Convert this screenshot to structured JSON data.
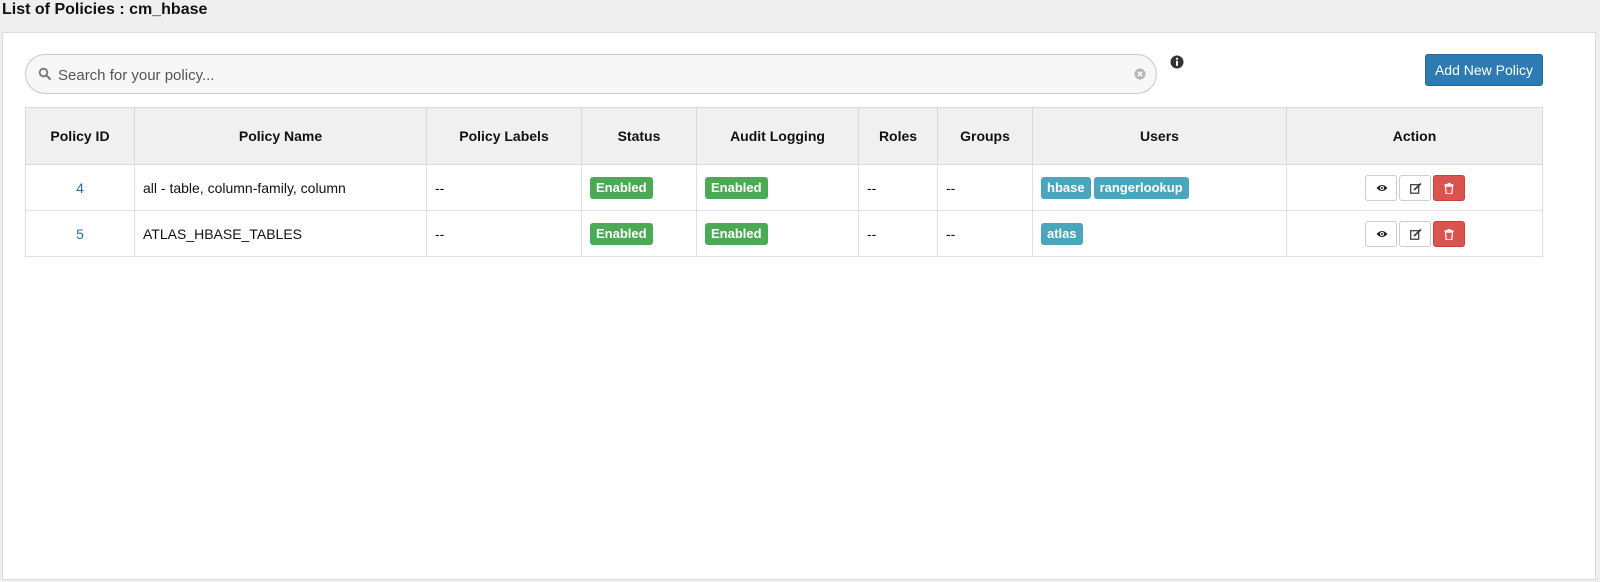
{
  "page": {
    "title": "List of Policies : cm_hbase"
  },
  "search": {
    "placeholder": "Search for your policy...",
    "value": ""
  },
  "toolbar": {
    "add_label": "Add New Policy"
  },
  "table": {
    "headers": [
      "Policy ID",
      "Policy Name",
      "Policy Labels",
      "Status",
      "Audit Logging",
      "Roles",
      "Groups",
      "Users",
      "Action"
    ],
    "rows": [
      {
        "id": "4",
        "name": "all - table, column-family, column",
        "labels": "--",
        "status": "Enabled",
        "audit": "Enabled",
        "roles": "--",
        "groups": "--",
        "users": [
          "hbase",
          "rangerlookup"
        ]
      },
      {
        "id": "5",
        "name": "ATLAS_HBASE_TABLES",
        "labels": "--",
        "status": "Enabled",
        "audit": "Enabled",
        "roles": "--",
        "groups": "--",
        "users": [
          "atlas"
        ]
      }
    ]
  },
  "icons": {
    "search": "search-icon",
    "clear": "clear-icon",
    "info": "info-icon",
    "view": "eye-icon",
    "edit": "edit-icon",
    "delete": "trash-icon"
  },
  "colors": {
    "primary": "#2e7bb3",
    "success": "#4caa57",
    "info": "#4aa6bd",
    "danger": "#d9534f",
    "link": "#2e6da4"
  }
}
